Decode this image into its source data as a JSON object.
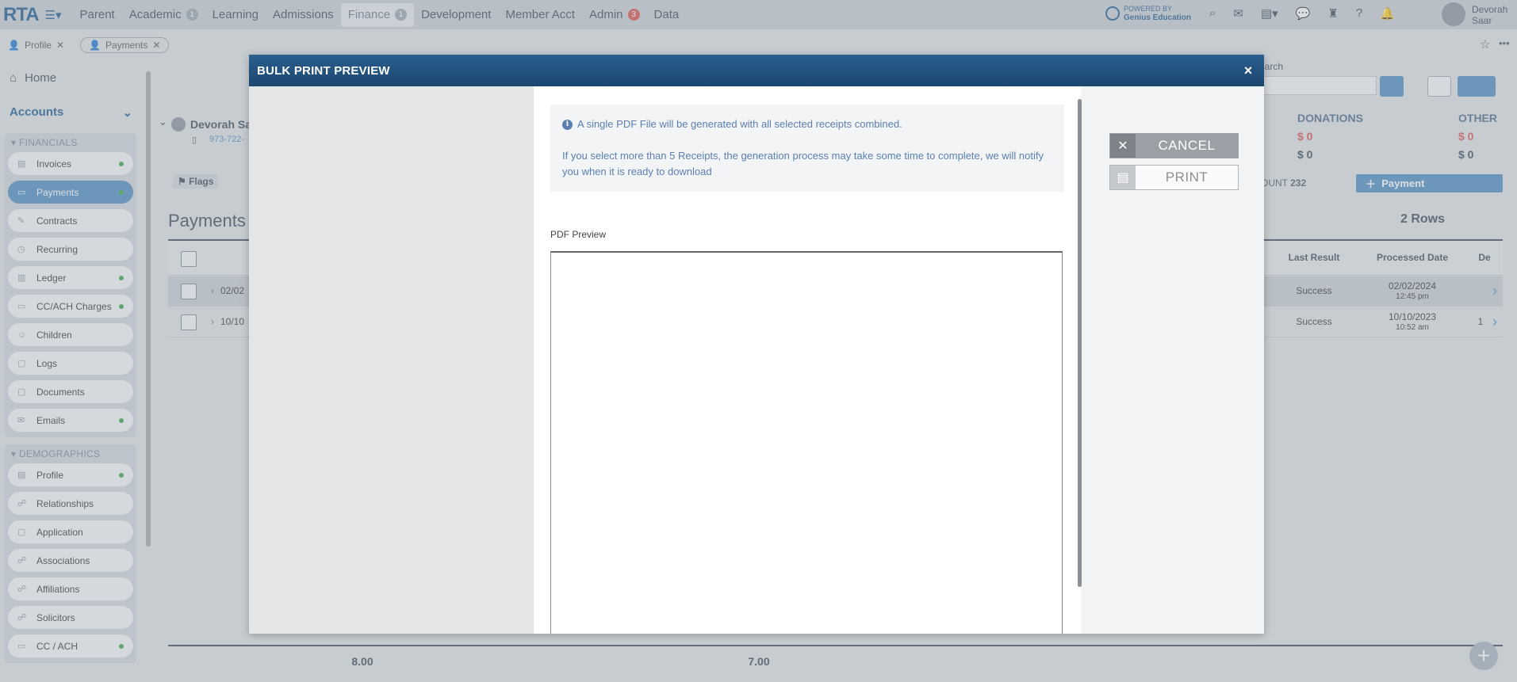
{
  "app": {
    "logo": "RTA",
    "nav": [
      {
        "label": "Parent",
        "badge": ""
      },
      {
        "label": "Academic",
        "badge": "1"
      },
      {
        "label": "Learning",
        "badge": ""
      },
      {
        "label": "Admissions",
        "badge": ""
      },
      {
        "label": "Finance",
        "badge": "1"
      },
      {
        "label": "Development",
        "badge": ""
      },
      {
        "label": "Member Acct",
        "badge": ""
      },
      {
        "label": "Admin",
        "badge": "3"
      },
      {
        "label": "Data",
        "badge": ""
      }
    ],
    "powered_by_line1": "POWERED BY",
    "powered_by_line2": "Genius Education",
    "user_first": "Devorah",
    "user_last": "Saar"
  },
  "tabs": {
    "profile": "Profile",
    "payments": "Payments"
  },
  "sidebar": {
    "home": "Home",
    "accounts": "Accounts",
    "financials_title": "FINANCIALS",
    "financials": [
      {
        "label": "Invoices",
        "dot": true,
        "icon": "invoice-icon",
        "glyph": "▤"
      },
      {
        "label": "Payments",
        "dot": true,
        "icon": "payment-icon",
        "glyph": "▭"
      },
      {
        "label": "Contracts",
        "dot": false,
        "icon": "contract-icon",
        "glyph": "✎"
      },
      {
        "label": "Recurring",
        "dot": false,
        "icon": "recurring-icon",
        "glyph": "◷"
      },
      {
        "label": "Ledger",
        "dot": true,
        "icon": "ledger-icon",
        "glyph": "▥"
      },
      {
        "label": "CC/ACH Charges",
        "dot": true,
        "icon": "card-icon",
        "glyph": "▭"
      },
      {
        "label": "Children",
        "dot": false,
        "icon": "child-icon",
        "glyph": "☺"
      },
      {
        "label": "Logs",
        "dot": false,
        "icon": "log-icon",
        "glyph": "▢"
      },
      {
        "label": "Documents",
        "dot": false,
        "icon": "document-icon",
        "glyph": "▢"
      },
      {
        "label": "Emails",
        "dot": true,
        "icon": "email-icon",
        "glyph": "✉"
      }
    ],
    "demographics_title": "DEMOGRAPHICS",
    "demographics": [
      {
        "label": "Profile",
        "dot": true,
        "icon": "profile-icon",
        "glyph": "▤"
      },
      {
        "label": "Relationships",
        "dot": false,
        "icon": "relationships-icon",
        "glyph": "☍"
      },
      {
        "label": "Application",
        "dot": false,
        "icon": "application-icon",
        "glyph": "▢"
      },
      {
        "label": "Associations",
        "dot": false,
        "icon": "associations-icon",
        "glyph": "☍"
      },
      {
        "label": "Affiliations",
        "dot": false,
        "icon": "affiliations-icon",
        "glyph": "☍"
      },
      {
        "label": "Solicitors",
        "dot": false,
        "icon": "solicitors-icon",
        "glyph": "☍"
      },
      {
        "label": "CC / ACH",
        "dot": true,
        "icon": "card-icon",
        "glyph": "▭"
      }
    ]
  },
  "background": {
    "contact_name": "Devorah Sa",
    "phone": "973-722-",
    "flags": "Flags",
    "page_title": "Payments",
    "search_label": "earch",
    "donations_label": "DONATIONS",
    "other_label": "OTHER",
    "donations_amt1": "$ 0",
    "donations_amt2": "$ 0",
    "other_amt1": "$ 0",
    "other_amt2": "$ 0",
    "count_label": "OUNT",
    "count_value": "232",
    "payment_button": "Payment",
    "rows_label": "2 Rows",
    "col_last_result": "Last Result",
    "col_processed_date": "Processed Date",
    "col_de": "De",
    "rows": [
      {
        "date_short": "02/02",
        "result": "Success",
        "processed": "02/02/2024",
        "time": "12:45 pm",
        "de": ""
      },
      {
        "date_short": "10/10",
        "result": "Success",
        "processed": "10/10/2023",
        "time": "10:52 am",
        "de": "1"
      }
    ],
    "footer_val1": "8.00",
    "footer_val2": "7.00"
  },
  "modal": {
    "title": "BULK PRINT PREVIEW",
    "info_line1": "A single PDF File will be generated with all selected receipts combined.",
    "info_line2": "If you select more than 5 Receipts, the generation process may take some time to complete, we will notify you when it is ready to download",
    "pdf_label": "PDF Preview",
    "cancel_label": "CANCEL",
    "print_label": "PRINT"
  },
  "colors": {
    "header_blue": "#1b466f",
    "accent_blue": "#4d8bc1",
    "success_green": "#3fa24b",
    "alert_red": "#d9534f"
  }
}
